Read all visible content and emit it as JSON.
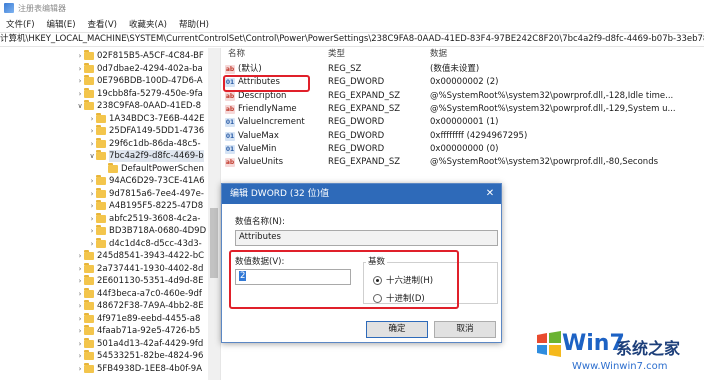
{
  "window": {
    "title": "注册表编辑器"
  },
  "menu": [
    "文件(F)",
    "编辑(E)",
    "查看(V)",
    "收藏夹(A)",
    "帮助(H)"
  ],
  "address": "计算机\\HKEY_LOCAL_MACHINE\\SYSTEM\\CurrentControlSet\\Control\\Power\\PowerSettings\\238C9FA8-0AAD-41ED-83F4-97BE242C8F20\\7bc4a2f9-d8fc-4469-b07b-33eb78",
  "tree": [
    {
      "label": "02F815B5-A5CF-4C84-BF"
    },
    {
      "label": "0d7dbae2-4294-402a-ba"
    },
    {
      "label": "0E796BDB-100D-47D6-A"
    },
    {
      "label": "19cbb8fa-5279-450e-9fa"
    },
    {
      "label": "238C9FA8-0AAD-41ED-8"
    },
    {
      "label": "1A34BDC3-7E6B-442E"
    },
    {
      "label": "25DFA149-5DD1-4736"
    },
    {
      "label": "29f6c1db-86da-48c5-"
    },
    {
      "label": "7bc4a2f9-d8fc-4469-b"
    },
    {
      "label": "DefaultPowerSchen"
    },
    {
      "label": "94AC6D29-73CE-41A6"
    },
    {
      "label": "9d7815a6-7ee4-497e-"
    },
    {
      "label": "A4B195F5-8225-47D8"
    },
    {
      "label": "abfc2519-3608-4c2a-"
    },
    {
      "label": "BD3B718A-0680-4D9D"
    },
    {
      "label": "d4c1d4c8-d5cc-43d3-"
    },
    {
      "label": "245d8541-3943-4422-bC"
    },
    {
      "label": "2a737441-1930-4402-8d"
    },
    {
      "label": "2E601130-5351-4d9d-8E"
    },
    {
      "label": "44f3beca-a7c0-460e-9df"
    },
    {
      "label": "48672F38-7A9A-4bb2-8E"
    },
    {
      "label": "4f971e89-eebd-4455-a8"
    },
    {
      "label": "4faab71a-92e5-4726-b5"
    },
    {
      "label": "501a4d13-42af-4429-9fd"
    },
    {
      "label": "54533251-82be-4824-96"
    },
    {
      "label": "5FB4938D-1EE8-4b0f-9A"
    }
  ],
  "list": {
    "headers": {
      "name": "名称",
      "type": "类型",
      "data": "数据"
    },
    "rows": [
      {
        "icon": "ab",
        "name": "(默认)",
        "type": "REG_SZ",
        "data": "(数值未设置)"
      },
      {
        "icon": "num",
        "name": "Attributes",
        "type": "REG_DWORD",
        "data": "0x00000002 (2)"
      },
      {
        "icon": "ab",
        "name": "Description",
        "type": "REG_EXPAND_SZ",
        "data": "@%SystemRoot%\\system32\\powrprof.dll,-128,Idle time..."
      },
      {
        "icon": "ab",
        "name": "FriendlyName",
        "type": "REG_EXPAND_SZ",
        "data": "@%SystemRoot%\\system32\\powrprof.dll,-129,System u..."
      },
      {
        "icon": "num",
        "name": "ValueIncrement",
        "type": "REG_DWORD",
        "data": "0x00000001 (1)"
      },
      {
        "icon": "num",
        "name": "ValueMax",
        "type": "REG_DWORD",
        "data": "0xffffffff (4294967295)"
      },
      {
        "icon": "num",
        "name": "ValueMin",
        "type": "REG_DWORD",
        "data": "0x00000000 (0)"
      },
      {
        "icon": "ab",
        "name": "ValueUnits",
        "type": "REG_EXPAND_SZ",
        "data": "@%SystemRoot%\\system32\\powrprof.dll,-80,Seconds"
      }
    ]
  },
  "dialog": {
    "title": "编辑 DWORD (32 位)值",
    "close": "✕",
    "name_label": "数值名称(N):",
    "name_value": "Attributes",
    "data_label": "数值数据(V):",
    "data_value": "2",
    "base_label": "基数",
    "radio_hex": "十六进制(H)",
    "radio_dec": "十进制(D)",
    "base_selected": "hex",
    "ok": "确定",
    "cancel": "取消"
  },
  "watermark": {
    "brand": "Win7",
    "name": "系统之家",
    "url": "Www.Winwin7.com"
  },
  "colors": {
    "highlight": "#e0202a",
    "dialog_title": "#2e6ab9"
  }
}
